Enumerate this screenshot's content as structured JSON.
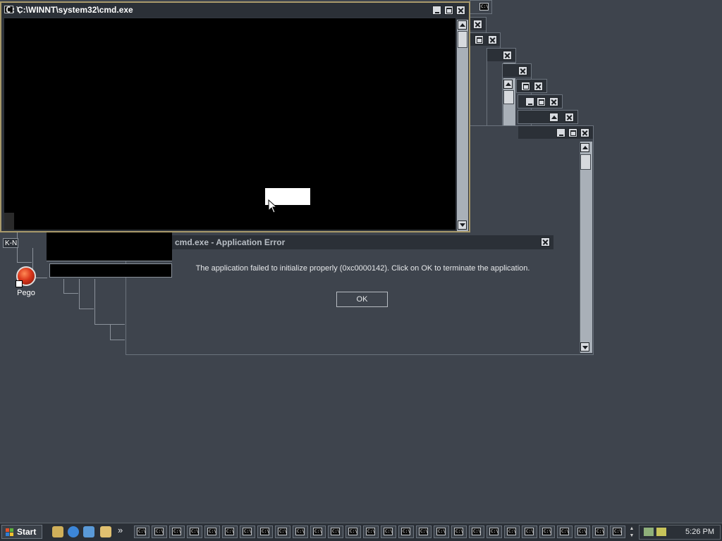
{
  "cmd_window": {
    "title": "C:\\WINNT\\system32\\cmd.exe",
    "icon": "cmd-icon"
  },
  "error_dialog": {
    "title": "cmd.exe - Application Error",
    "message": "The application failed to initialize properly (0xc0000142). Click on OK to terminate the application.",
    "ok_label": "OK"
  },
  "desktop": {
    "partial_label": "K-N",
    "pego_icon_label": "Pego"
  },
  "taskbar": {
    "start_label": "Start",
    "quick_launch": [
      "show-desktop-icon",
      "internet-explorer-icon",
      "outlook-express-icon",
      "windows-explorer-icon"
    ],
    "chevron": "»",
    "task_icon": "C:\\",
    "task_button_count": 28,
    "clock": "5:26 PM"
  },
  "colors": {
    "desktop": "#3e444d",
    "titlebar": "#2b3037",
    "cmd_border": "#a99a6b"
  }
}
